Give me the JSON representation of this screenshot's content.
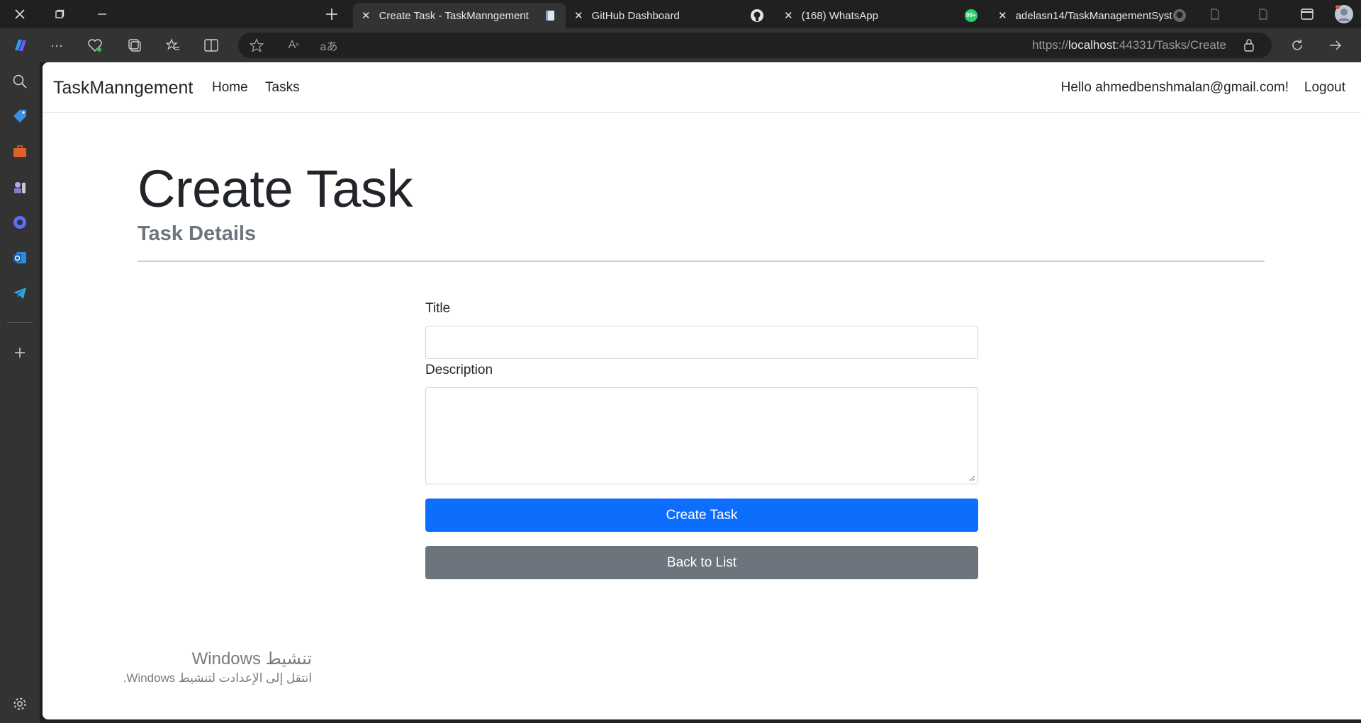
{
  "browser": {
    "tabs": [
      {
        "title": "Create Task - TaskManngement",
        "active": true
      },
      {
        "title": "GitHub Dashboard",
        "active": false
      },
      {
        "title": "(168) WhatsApp",
        "active": false
      },
      {
        "title": "adelasn14/TaskManagementSyst",
        "active": false
      }
    ],
    "whatsapp_badge": "99+",
    "url_prefix": "https://",
    "url_host": "localhost",
    "url_rest": ":44331/Tasks/Create"
  },
  "navbar": {
    "brand": "TaskManngement",
    "links": [
      "Home",
      "Tasks"
    ],
    "greeting": "Hello ahmedbenshmalan@gmail.com!",
    "logout": "Logout"
  },
  "page": {
    "title": "Create Task",
    "subtitle": "Task Details"
  },
  "form": {
    "title_label": "Title",
    "title_value": "",
    "description_label": "Description",
    "description_value": "",
    "submit_label": "Create Task",
    "back_label": "Back to List"
  },
  "watermark": {
    "line1": "تنشيط Windows",
    "line2": "انتقل إلى الإعدادت لتنشيط Windows."
  },
  "colors": {
    "primary": "#0d6efd",
    "secondary": "#6c757d",
    "subtitle": "#6c757d"
  }
}
